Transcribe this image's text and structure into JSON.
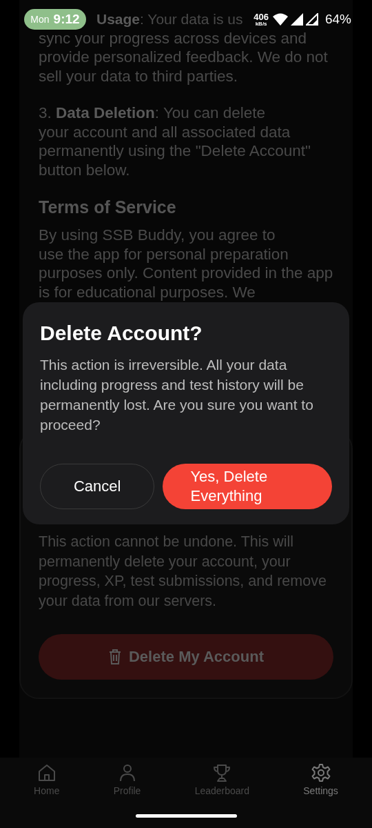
{
  "status_bar": {
    "day": "Mon",
    "time": "9:12",
    "net_speed": "406",
    "net_unit": "kB/s",
    "battery": "64%"
  },
  "policy": {
    "partial_line": "**Usage**: Your data is us",
    "paragraphs": [
      "sync your progress across devices and provide personalized feedback. We do not sell your data to third parties.",
      "3. **Data Deletion**: You can delete\nyour account and all associated data permanently using the \"Delete Account\" button below."
    ],
    "heading": "Terms of Service",
    "terms": "By using SSB Buddy, you agree to\nuse the app for personal preparation purposes only. Content provided in the app is for educational purposes. We"
  },
  "danger_card": {
    "warning": "This action cannot be undone. This will permanently delete your account, your progress, XP, test submissions, and remove your data from our servers.",
    "button": "Delete My Account"
  },
  "dialog": {
    "title": "Delete Account?",
    "message": "This action is irreversible. All your data including progress and test history will be permanently lost. Are you sure you want to proceed?",
    "buttons": [
      {
        "label": "Cancel",
        "kind": "secondary"
      },
      {
        "label": "Yes, Delete Everything",
        "kind": "danger"
      }
    ]
  },
  "nav": [
    {
      "label": "Home",
      "selected": false
    },
    {
      "label": "Profile",
      "selected": false
    },
    {
      "label": "Leaderboard",
      "selected": false
    },
    {
      "label": "Settings",
      "selected": true
    }
  ]
}
